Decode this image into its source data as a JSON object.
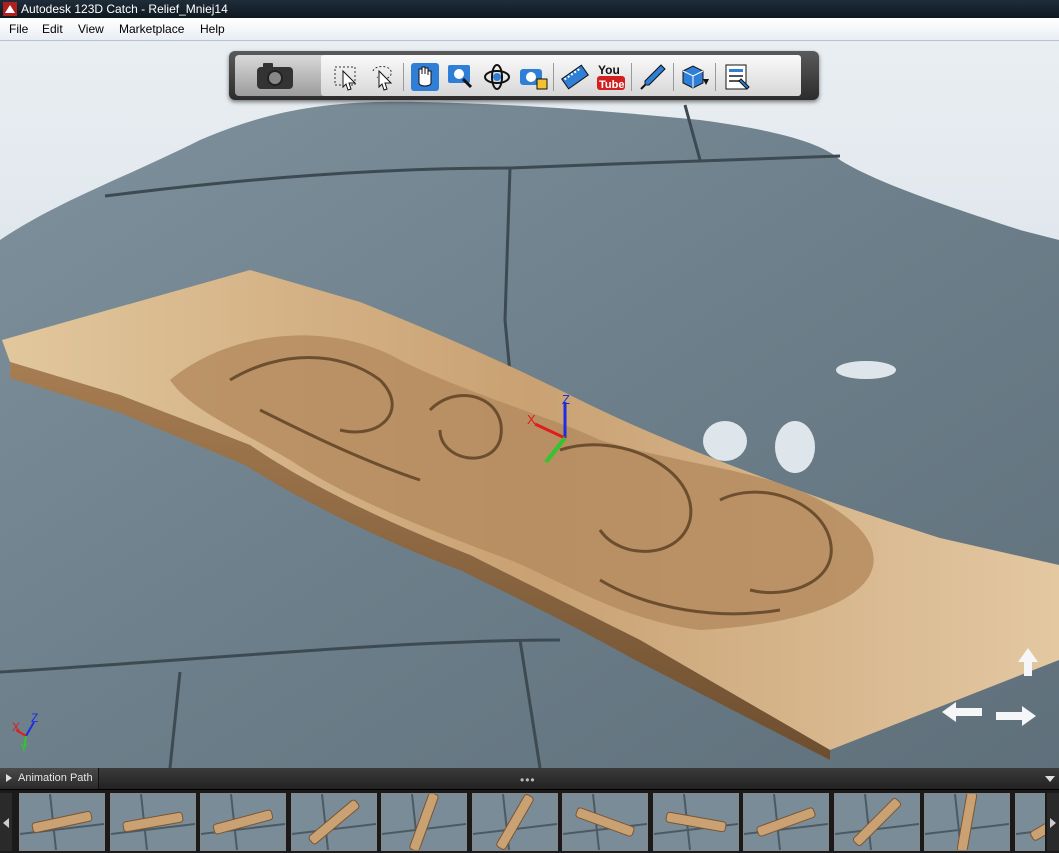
{
  "window": {
    "title": "Autodesk 123D Catch - Relief_Mniej14",
    "app_icon": "app-logo-icon"
  },
  "menu": [
    "File",
    "Edit",
    "View",
    "Marketplace",
    "Help"
  ],
  "toolbar": {
    "primary": "camera-icon",
    "tools": [
      "select-arrow-icon",
      "lasso-select-icon",
      "pan-hand-icon",
      "zoom-icon",
      "orbit-icon",
      "camera-lock-icon",
      "film-strip-icon",
      "youtube-icon",
      "pipette-icon",
      "export-cube-icon",
      "settings-sheet-icon"
    ],
    "youtube_text": {
      "top": "You",
      "bottom": "Tube"
    }
  },
  "axis_labels": {
    "x": "X",
    "y": "Y",
    "z": "Z"
  },
  "animation": {
    "label": "Animation Path",
    "dots": "•••",
    "thumb_count": 12
  },
  "colors": {
    "accent": "#2f7fd6",
    "axis_x": "#e01c1c",
    "axis_y": "#2fc62f",
    "axis_z": "#1c2ee0"
  }
}
